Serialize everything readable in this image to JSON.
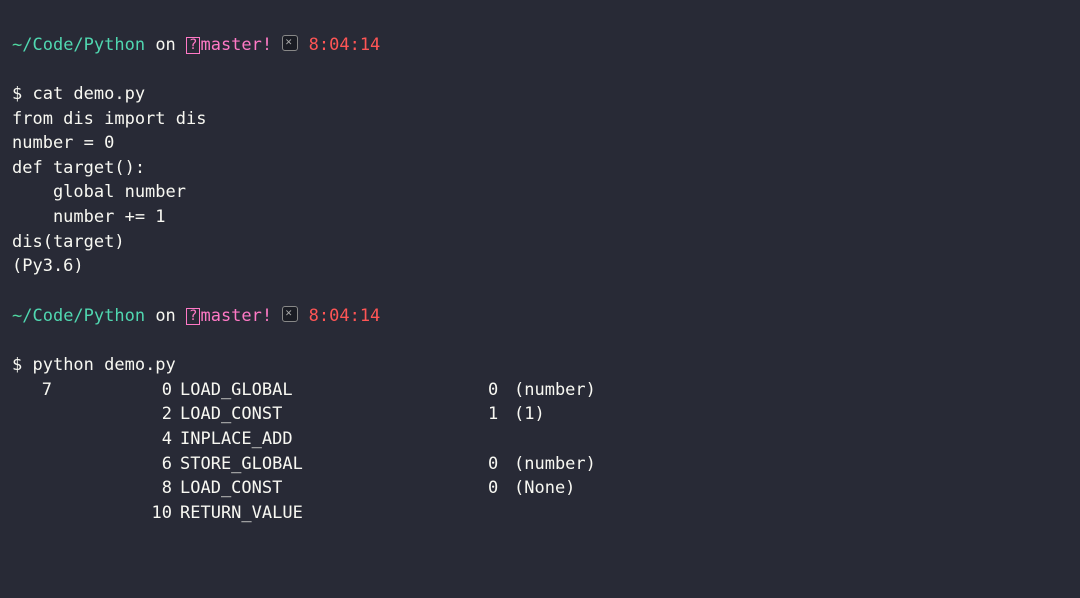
{
  "prompt1": {
    "tilde": "~",
    "path": "/Code/Python",
    "on": " on ",
    "branch_box": "?",
    "branch": "master",
    "dirty": "!",
    "time": "8:04:14"
  },
  "cmd1": {
    "dollar": "$ ",
    "command": "cat demo.py"
  },
  "file_lines": [
    "from dis import dis",
    "",
    "number = 0",
    "",
    "def target():",
    "    global number",
    "    number += 1",
    "",
    "dis(target)",
    "(Py3.6)"
  ],
  "prompt2": {
    "tilde": "~",
    "path": "/Code/Python",
    "on": " on ",
    "branch_box": "?",
    "branch": "master",
    "dirty": "!",
    "time": "8:04:14"
  },
  "cmd2": {
    "dollar": "$ ",
    "command": "python demo.py"
  },
  "dis_output": [
    {
      "lineno": "7",
      "offset": "0",
      "opname": "LOAD_GLOBAL",
      "arg": "0",
      "argval": "(number)"
    },
    {
      "lineno": "",
      "offset": "2",
      "opname": "LOAD_CONST",
      "arg": "1",
      "argval": "(1)"
    },
    {
      "lineno": "",
      "offset": "4",
      "opname": "INPLACE_ADD",
      "arg": "",
      "argval": ""
    },
    {
      "lineno": "",
      "offset": "6",
      "opname": "STORE_GLOBAL",
      "arg": "0",
      "argval": "(number)"
    },
    {
      "lineno": "",
      "offset": "8",
      "opname": "LOAD_CONST",
      "arg": "0",
      "argval": "(None)"
    },
    {
      "lineno": "",
      "offset": "10",
      "opname": "RETURN_VALUE",
      "arg": "",
      "argval": ""
    }
  ]
}
